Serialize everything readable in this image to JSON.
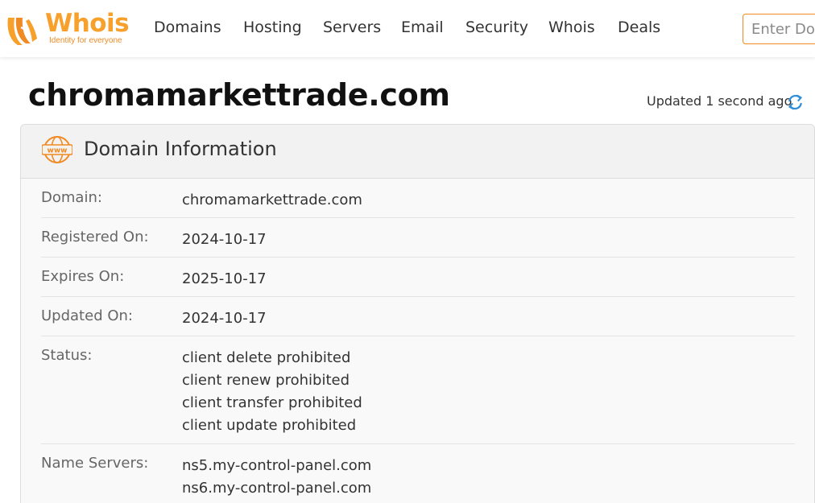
{
  "header": {
    "logo_text": "Whois",
    "logo_tagline": "Identity for everyone",
    "nav": [
      "Domains",
      "Hosting",
      "Servers",
      "Email",
      "Security",
      "Whois",
      "Deals"
    ],
    "search_placeholder": "Enter Domain or IP"
  },
  "page": {
    "title": "chromamarkettrade.com",
    "updated": "Updated 1 second ago"
  },
  "panel": {
    "title": "Domain Information",
    "rows": [
      {
        "label": "Domain:",
        "values": [
          "chromamarkettrade.com"
        ]
      },
      {
        "label": "Registered On:",
        "values": [
          "2024-10-17"
        ]
      },
      {
        "label": "Expires On:",
        "values": [
          "2025-10-17"
        ]
      },
      {
        "label": "Updated On:",
        "values": [
          "2024-10-17"
        ]
      },
      {
        "label": "Status:",
        "values": [
          "client delete prohibited",
          "client renew prohibited",
          "client transfer prohibited",
          "client update prohibited"
        ]
      },
      {
        "label": "Name Servers:",
        "values": [
          "ns5.my-control-panel.com",
          "ns6.my-control-panel.com"
        ]
      }
    ]
  },
  "colors": {
    "brand_orange": "#f7a02b",
    "accent_orange": "#f08a24",
    "refresh_blue": "#2f8fd8"
  },
  "icons": {
    "logo": "whois-logo-icon",
    "refresh": "refresh-icon",
    "www": "www-globe-icon"
  }
}
